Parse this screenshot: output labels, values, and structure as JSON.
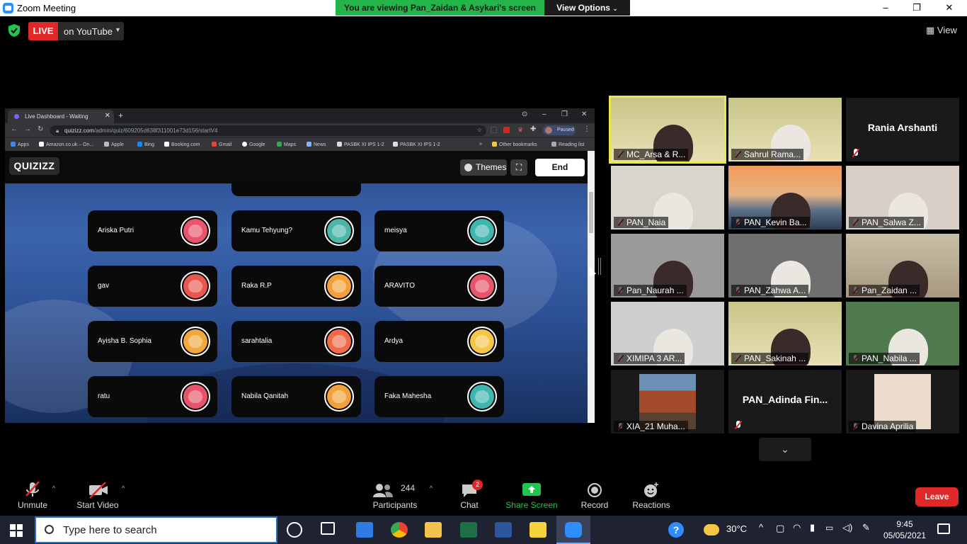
{
  "window": {
    "title": "Zoom Meeting",
    "viewing_banner": "You are viewing Pan_Zaidan & Asykari's screen",
    "view_options": "View Options",
    "controls": [
      "–",
      "❐",
      "✕"
    ]
  },
  "status": {
    "live_label": "LIVE",
    "live_target": "on YouTube",
    "view_label": "View"
  },
  "browser": {
    "tab_title": "Live Dashboard - Waiting",
    "url_host": "quizizz.com",
    "url_path": "/admin/quiz/609205d638f311001e73d156/startV4",
    "profile_status": "Paused",
    "bookmarks": [
      "Apps",
      "Amazon.co.uk – On...",
      "Apple",
      "Bing",
      "Booking.com",
      "Gmail",
      "Google",
      "Maps",
      "News",
      "PASBK XI IPS 1-2",
      "PASBK XI IPS 1-2",
      "»",
      "Other bookmarks",
      "Reading list"
    ]
  },
  "quizizz": {
    "logo": "QUIZIZZ",
    "themes_label": "Themes",
    "end_label": "End",
    "players": [
      {
        "name": "Ariska Putri",
        "color": "#e8546b"
      },
      {
        "name": "Kamu Tehyung?",
        "color": "#49b6a8"
      },
      {
        "name": "meisya",
        "color": "#3fb5b0"
      },
      {
        "name": "gav",
        "color": "#e9574f"
      },
      {
        "name": "Raka R.P",
        "color": "#f2a13a"
      },
      {
        "name": "ARAVITO",
        "color": "#e8546b"
      },
      {
        "name": "Ayisha B. Sophia",
        "color": "#f0a83a"
      },
      {
        "name": "sarahtalia",
        "color": "#f06a4a"
      },
      {
        "name": "Ardya",
        "color": "#f5c54a"
      },
      {
        "name": "ratu",
        "color": "#e8546b"
      },
      {
        "name": "Nabila Qanitah",
        "color": "#f2a13a"
      },
      {
        "name": "Faka Mahesha",
        "color": "#3fb5b0"
      }
    ]
  },
  "gallery": {
    "tiles": [
      {
        "name": "MC_Arsa & R...",
        "speaking": true
      },
      {
        "name": "Sahrul Rama..."
      },
      {
        "name": "Rania Arshanti",
        "video_off": true
      },
      {
        "name": "PAN_Naia"
      },
      {
        "name": "PAN_Kevin Ba..."
      },
      {
        "name": "PAN_Salwa Z..."
      },
      {
        "name": "Pan_Naurah ..."
      },
      {
        "name": "PAN_Zahwa A..."
      },
      {
        "name": "Pan_Zaidan ..."
      },
      {
        "name": "XIMIPA 3 AR..."
      },
      {
        "name": "PAN_Sakinah ..."
      },
      {
        "name": "PAN_Nabila ..."
      },
      {
        "name": "XIA_21 Muha..."
      },
      {
        "name": "PAN_Adinda  Fin...",
        "video_off": true
      },
      {
        "name": "Davina Aprilia"
      }
    ]
  },
  "toolbar": {
    "unmute": "Unmute",
    "start_video": "Start Video",
    "participants_count": "244",
    "participants": "Participants",
    "chat": "Chat",
    "chat_badge": "2",
    "share_screen": "Share Screen",
    "record": "Record",
    "reactions": "Reactions",
    "leave": "Leave"
  },
  "taskbar": {
    "search_placeholder": "Type here to search",
    "temperature": "30°C",
    "time": "9:45",
    "date": "05/05/2021"
  }
}
